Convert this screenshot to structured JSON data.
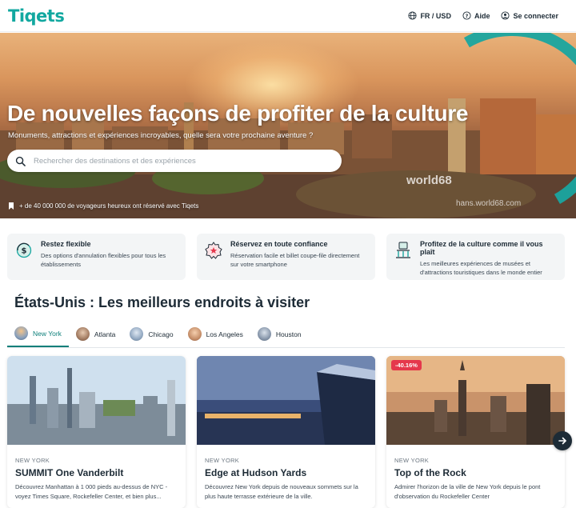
{
  "header": {
    "logo": "Tiqets",
    "currency": "FR / USD",
    "help": "Aide",
    "login": "Se connecter"
  },
  "hero": {
    "title": "De nouvelles façons de profiter de la culture",
    "subtitle": "Monuments, attractions et expériences incroyables, quelle sera votre prochaine aventure ?",
    "search_placeholder": "Rechercher des destinations et des expériences",
    "trust": "+ de 40 000 000 de voyageurs heureux ont réservé avec Tiqets",
    "watermark": "world68",
    "watermark_url": "hans.world68.com"
  },
  "features": [
    {
      "title": "Restez flexible",
      "text": "Des options d'annulation flexibles pour tous les établissements",
      "icon": "refund-icon"
    },
    {
      "title": "Réservez en toute confiance",
      "text": "Réservation facile et billet coupe-file directement sur votre smartphone",
      "icon": "badge-icon"
    },
    {
      "title": "Profitez de la culture comme il vous plaît",
      "text": "Les meilleures expériences de musées et d'attractions touristiques dans le monde entier",
      "icon": "museum-icon"
    }
  ],
  "section": {
    "title": "États-Unis : Les meilleurs endroits à visiter",
    "tabs": [
      "New York",
      "Atlanta",
      "Chicago",
      "Los Angeles",
      "Houston"
    ]
  },
  "cards": [
    {
      "location": "NEW YORK",
      "title": "SUMMIT One Vanderbilt",
      "text": "Découvrez Manhattan à 1 000 pieds au-dessus de NYC - voyez Times Square, Rockefeller Center, et bien plus..."
    },
    {
      "location": "NEW YORK",
      "title": "Edge at Hudson Yards",
      "text": "Découvrez New York depuis de nouveaux sommets sur la plus haute terrasse extérieure de la ville."
    },
    {
      "location": "NEW YORK",
      "title": "Top of the Rock",
      "text": "Admirer l'horizon de la ville de New York depuis le pont d'observation du Rockefeller Center",
      "badge": "-40.16%"
    }
  ],
  "colors": {
    "brand": "#12a8a0",
    "accent": "#0d7f7a",
    "discount": "#e5374c"
  }
}
